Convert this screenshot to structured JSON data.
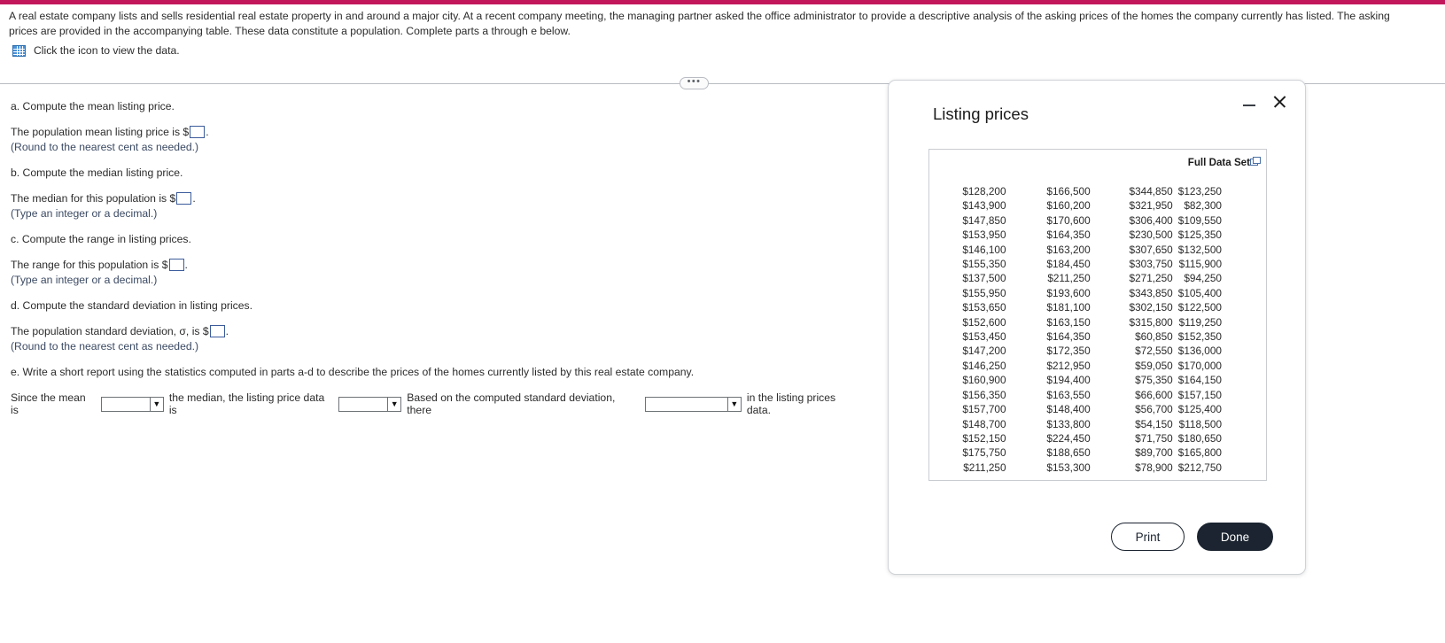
{
  "theme": {
    "accent_bar": "#c2185b",
    "dialog_primary": "#1b2430",
    "blank_border": "#3b5b9b",
    "icon_blue": "#4a90d9"
  },
  "problem": {
    "statement": "A real estate company lists and sells residential real estate property in and around a major city. At a recent company meeting, the managing partner asked the office administrator to provide a descriptive analysis of the asking prices of the homes the company currently has listed. The asking prices are provided in the accompanying table. These data constitute a population. Complete parts a through e below.",
    "icon_hint": "Click the icon to view the data.",
    "icon_name": "data-table-icon",
    "divider_handle": "•••"
  },
  "questions": {
    "a": {
      "prompt": "a. Compute the mean listing price.",
      "answer_pre": "The population mean listing price is $",
      "answer_post": ".",
      "note": "(Round to the nearest cent as needed.)"
    },
    "b": {
      "prompt": "b. Compute the median listing price.",
      "answer_pre": "The median for this population is $",
      "answer_post": ".",
      "note": "(Type an integer or a decimal.)"
    },
    "c": {
      "prompt": "c. Compute the range in listing prices.",
      "answer_pre": "The range for this population is $",
      "answer_post": ".",
      "note": "(Type an integer or a decimal.)"
    },
    "d": {
      "prompt": "d. Compute the standard deviation in listing prices.",
      "answer_pre": "The population standard deviation, σ, is $",
      "answer_post": ".",
      "note": "(Round to the nearest cent as needed.)"
    },
    "e": {
      "prompt": "e. Write a short report using the statistics computed in parts a-d to describe the prices of the homes currently listed by this real estate company.",
      "sentence_1": "Since the mean is",
      "sentence_2": "the median, the listing price data is",
      "sentence_3": "Based on the computed standard deviation, there",
      "sentence_4": "in the listing prices data.",
      "dropdown_1_value": "",
      "dropdown_2_value": "",
      "dropdown_3_value": ""
    }
  },
  "dialog": {
    "title": "Listing prices",
    "minimize_icon": "minimize-icon",
    "close_icon": "close-icon",
    "full_data_set_label": "Full Data Set",
    "copy_icon": "copy-icon",
    "print_label": "Print",
    "done_label": "Done",
    "table_rows": [
      [
        "$128,200",
        "$166,500",
        "$344,850",
        "$123,250"
      ],
      [
        "$143,900",
        "$160,200",
        "$321,950",
        "$82,300"
      ],
      [
        "$147,850",
        "$170,600",
        "$306,400",
        "$109,550"
      ],
      [
        "$153,950",
        "$164,350",
        "$230,500",
        "$125,350"
      ],
      [
        "$146,100",
        "$163,200",
        "$307,650",
        "$132,500"
      ],
      [
        "$155,350",
        "$184,450",
        "$303,750",
        "$115,900"
      ],
      [
        "$137,500",
        "$211,250",
        "$271,250",
        "$94,250"
      ],
      [
        "$155,950",
        "$193,600",
        "$343,850",
        "$105,400"
      ],
      [
        "$153,650",
        "$181,100",
        "$302,150",
        "$122,500"
      ],
      [
        "$152,600",
        "$163,150",
        "$315,800",
        "$119,250"
      ],
      [
        "$153,450",
        "$164,350",
        "$60,850",
        "$152,350"
      ],
      [
        "$147,200",
        "$172,350",
        "$72,550",
        "$136,000"
      ],
      [
        "$146,250",
        "$212,950",
        "$59,050",
        "$170,000"
      ],
      [
        "$160,900",
        "$194,400",
        "$75,350",
        "$164,150"
      ],
      [
        "$156,350",
        "$163,550",
        "$66,600",
        "$157,150"
      ],
      [
        "$157,700",
        "$148,400",
        "$56,700",
        "$125,400"
      ],
      [
        "$148,700",
        "$133,800",
        "$54,150",
        "$118,500"
      ],
      [
        "$152,150",
        "$224,450",
        "$71,750",
        "$180,650"
      ],
      [
        "$175,750",
        "$188,650",
        "$89,700",
        "$165,800"
      ],
      [
        "$211,250",
        "$153,300",
        "$78,900",
        "$212,750"
      ]
    ]
  }
}
